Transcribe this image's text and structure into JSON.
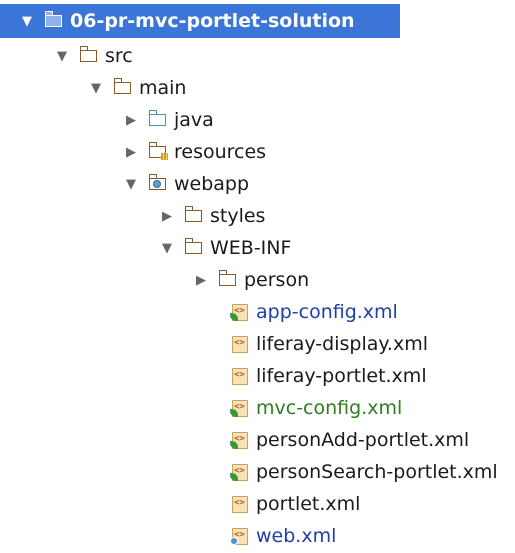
{
  "tree": {
    "root": {
      "label": "06-pr-mvc-portlet-solution",
      "arrow": "▼",
      "icon": "project-folder-icon"
    },
    "src": {
      "label": "src",
      "arrow": "▼"
    },
    "main": {
      "label": "main",
      "arrow": "▼"
    },
    "java": {
      "label": "java",
      "arrow": "▶"
    },
    "resources": {
      "label": "resources",
      "arrow": "▶"
    },
    "webapp": {
      "label": "webapp",
      "arrow": "▼"
    },
    "styles": {
      "label": "styles",
      "arrow": "▶"
    },
    "webinf": {
      "label": "WEB-INF",
      "arrow": "▼"
    },
    "person": {
      "label": "person",
      "arrow": "▶"
    },
    "files": [
      {
        "label": "app-config.xml",
        "color": "#1f3fa8"
      },
      {
        "label": "liferay-display.xml",
        "color": "#1a1a1a"
      },
      {
        "label": "liferay-portlet.xml",
        "color": "#1a1a1a"
      },
      {
        "label": "mvc-config.xml",
        "color": "#2e7d1e"
      },
      {
        "label": "personAdd-portlet.xml",
        "color": "#1a1a1a"
      },
      {
        "label": "personSearch-portlet.xml",
        "color": "#1a1a1a"
      },
      {
        "label": "portlet.xml",
        "color": "#1a1a1a"
      },
      {
        "label": "web.xml",
        "color": "#1f3fa8"
      }
    ]
  },
  "colors": {
    "selection": "#3b75d8",
    "folder": "#8a5a2b",
    "source_folder": "#4a8fc8"
  }
}
